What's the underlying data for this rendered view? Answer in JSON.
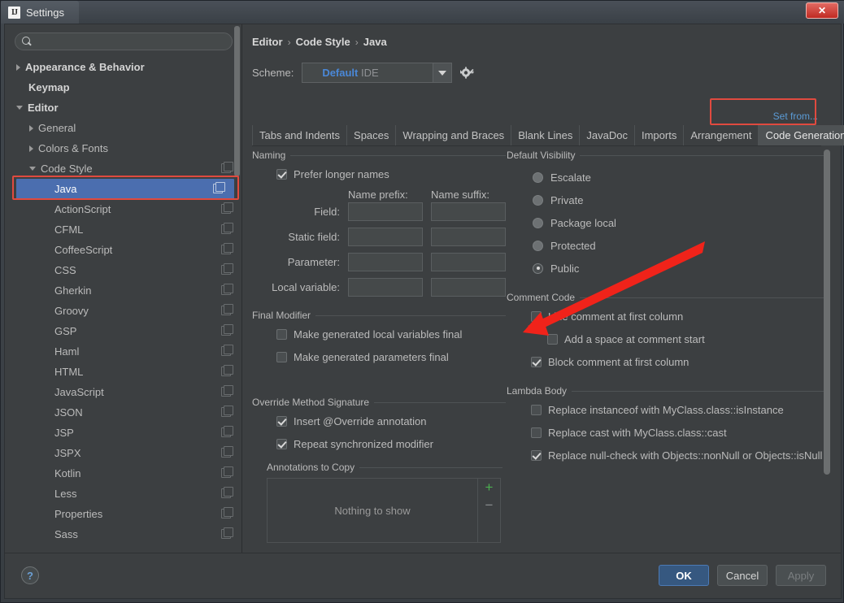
{
  "window": {
    "title": "Settings",
    "logo_text": "IJ",
    "close_label": "✕"
  },
  "sidebar": {
    "search": {
      "value": "",
      "placeholder": "",
      "icon": "search-icon"
    },
    "items": [
      {
        "label": "Appearance & Behavior",
        "twisty": "collapsed",
        "indent": 0,
        "bold": true,
        "copy": false,
        "selected": false
      },
      {
        "label": "Keymap",
        "twisty": "none",
        "indent": 0,
        "bold": true,
        "copy": false,
        "selected": false
      },
      {
        "label": "Editor",
        "twisty": "expanded",
        "indent": 0,
        "bold": true,
        "copy": false,
        "selected": false
      },
      {
        "label": "General",
        "twisty": "collapsed",
        "indent": 1,
        "bold": false,
        "copy": false,
        "selected": false
      },
      {
        "label": "Colors & Fonts",
        "twisty": "collapsed",
        "indent": 1,
        "bold": false,
        "copy": false,
        "selected": false
      },
      {
        "label": "Code Style",
        "twisty": "expanded",
        "indent": 1,
        "bold": false,
        "copy": true,
        "selected": false
      },
      {
        "label": "Java",
        "twisty": "none",
        "indent": 2,
        "bold": false,
        "copy": true,
        "selected": true
      },
      {
        "label": "ActionScript",
        "twisty": "none",
        "indent": 2,
        "bold": false,
        "copy": true,
        "selected": false
      },
      {
        "label": "CFML",
        "twisty": "none",
        "indent": 2,
        "bold": false,
        "copy": true,
        "selected": false
      },
      {
        "label": "CoffeeScript",
        "twisty": "none",
        "indent": 2,
        "bold": false,
        "copy": true,
        "selected": false
      },
      {
        "label": "CSS",
        "twisty": "none",
        "indent": 2,
        "bold": false,
        "copy": true,
        "selected": false
      },
      {
        "label": "Gherkin",
        "twisty": "none",
        "indent": 2,
        "bold": false,
        "copy": true,
        "selected": false
      },
      {
        "label": "Groovy",
        "twisty": "none",
        "indent": 2,
        "bold": false,
        "copy": true,
        "selected": false
      },
      {
        "label": "GSP",
        "twisty": "none",
        "indent": 2,
        "bold": false,
        "copy": true,
        "selected": false
      },
      {
        "label": "Haml",
        "twisty": "none",
        "indent": 2,
        "bold": false,
        "copy": true,
        "selected": false
      },
      {
        "label": "HTML",
        "twisty": "none",
        "indent": 2,
        "bold": false,
        "copy": true,
        "selected": false
      },
      {
        "label": "JavaScript",
        "twisty": "none",
        "indent": 2,
        "bold": false,
        "copy": true,
        "selected": false
      },
      {
        "label": "JSON",
        "twisty": "none",
        "indent": 2,
        "bold": false,
        "copy": true,
        "selected": false
      },
      {
        "label": "JSP",
        "twisty": "none",
        "indent": 2,
        "bold": false,
        "copy": true,
        "selected": false
      },
      {
        "label": "JSPX",
        "twisty": "none",
        "indent": 2,
        "bold": false,
        "copy": true,
        "selected": false
      },
      {
        "label": "Kotlin",
        "twisty": "none",
        "indent": 2,
        "bold": false,
        "copy": true,
        "selected": false
      },
      {
        "label": "Less",
        "twisty": "none",
        "indent": 2,
        "bold": false,
        "copy": true,
        "selected": false
      },
      {
        "label": "Properties",
        "twisty": "none",
        "indent": 2,
        "bold": false,
        "copy": true,
        "selected": false
      },
      {
        "label": "Sass",
        "twisty": "none",
        "indent": 2,
        "bold": false,
        "copy": true,
        "selected": false
      }
    ]
  },
  "breadcrumb": {
    "items": [
      "Editor",
      "Code Style",
      "Java"
    ],
    "separator": "›"
  },
  "scheme": {
    "label": "Scheme:",
    "name": "Default",
    "kind": "IDE",
    "gear_icon": "gear-icon",
    "dropdown_icon": "chevron-down-icon"
  },
  "set_from": "Set from...",
  "tabs": {
    "items": [
      "Tabs and Indents",
      "Spaces",
      "Wrapping and Braces",
      "Blank Lines",
      "JavaDoc",
      "Imports",
      "Arrangement",
      "Code Generation"
    ],
    "active": "Code Generation",
    "overflow_count": "1"
  },
  "sections": {
    "naming": {
      "title": "Naming",
      "prefer_longer_names": {
        "label": "Prefer longer names",
        "checked": true
      },
      "col_prefix": "Name prefix:",
      "col_suffix": "Name suffix:",
      "rows": [
        {
          "label": "Field:",
          "prefix": "",
          "suffix": ""
        },
        {
          "label": "Static field:",
          "prefix": "",
          "suffix": ""
        },
        {
          "label": "Parameter:",
          "prefix": "",
          "suffix": ""
        },
        {
          "label": "Local variable:",
          "prefix": "",
          "suffix": ""
        }
      ]
    },
    "default_visibility": {
      "title": "Default Visibility",
      "options": [
        {
          "label": "Escalate",
          "mnemonic": "E",
          "checked": false
        },
        {
          "label": "Private",
          "mnemonic": "v",
          "checked": false
        },
        {
          "label": "Package local",
          "mnemonic": "",
          "checked": false
        },
        {
          "label": "Protected",
          "mnemonic": "o",
          "checked": false
        },
        {
          "label": "Public",
          "mnemonic": "b",
          "checked": true
        }
      ]
    },
    "final_modifier": {
      "title": "Final Modifier",
      "options": [
        {
          "label": "Make generated local variables final",
          "checked": false
        },
        {
          "label": "Make generated parameters final",
          "checked": false
        }
      ]
    },
    "comment_code": {
      "title": "Comment Code",
      "options": [
        {
          "label": "Line comment at first column",
          "checked": false,
          "indent": false
        },
        {
          "label": "Add a space at comment start",
          "checked": false,
          "indent": true
        },
        {
          "label": "Block comment at first column",
          "checked": true,
          "indent": false
        }
      ]
    },
    "override_method_signature": {
      "title": "Override Method Signature",
      "options": [
        {
          "label": "Insert @Override annotation",
          "checked": true
        },
        {
          "label": "Repeat synchronized modifier",
          "checked": true
        }
      ],
      "annotations_to_copy": {
        "title": "Annotations to Copy",
        "empty_text": "Nothing to show",
        "add_label": "+",
        "remove_label": "−"
      }
    },
    "lambda_body": {
      "title": "Lambda Body",
      "options": [
        {
          "label": "Replace instanceof with MyClass.class::isInstance",
          "checked": false
        },
        {
          "label": "Replace cast with MyClass.class::cast",
          "checked": false
        },
        {
          "label": "Replace null-check with Objects::nonNull or Objects::isNull",
          "checked": true
        }
      ]
    }
  },
  "footer": {
    "help_label": "?",
    "ok": "OK",
    "cancel": "Cancel",
    "apply": "Apply"
  },
  "colors": {
    "accent": "#4b6eaf",
    "link": "#5b9bd5",
    "annotation": "#e8372c",
    "background": "#3c3f41"
  }
}
